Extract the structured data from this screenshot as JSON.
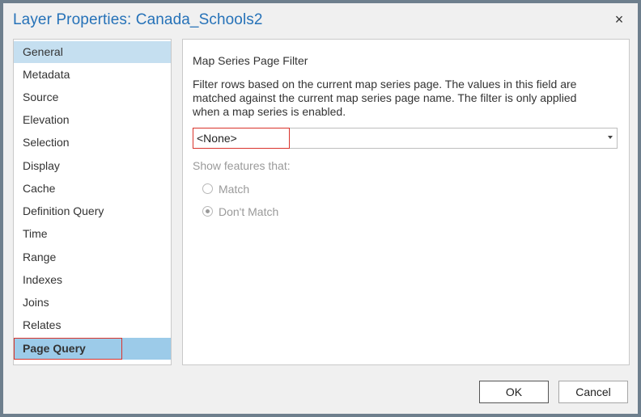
{
  "dialog": {
    "title": "Layer Properties: Canada_Schools2",
    "close_label": "×"
  },
  "nav": {
    "items": [
      {
        "label": "General"
      },
      {
        "label": "Metadata"
      },
      {
        "label": "Source"
      },
      {
        "label": "Elevation"
      },
      {
        "label": "Selection"
      },
      {
        "label": "Display"
      },
      {
        "label": "Cache"
      },
      {
        "label": "Definition Query"
      },
      {
        "label": "Time"
      },
      {
        "label": "Range"
      },
      {
        "label": "Indexes"
      },
      {
        "label": "Joins"
      },
      {
        "label": "Relates"
      },
      {
        "label": "Page Query"
      }
    ],
    "active": "Page Query"
  },
  "panel": {
    "section_title": "Map Series Page Filter",
    "description": "Filter rows based on the current map series page. The values in this field are matched against the current map series page name. The filter is only applied when a map series is enabled.",
    "field_select": {
      "value": "<None>"
    },
    "show_features_label": "Show features that:",
    "options": [
      {
        "label": "Match",
        "checked": false
      },
      {
        "label": "Don't Match",
        "checked": true
      }
    ]
  },
  "buttons": {
    "ok": "OK",
    "cancel": "Cancel"
  }
}
